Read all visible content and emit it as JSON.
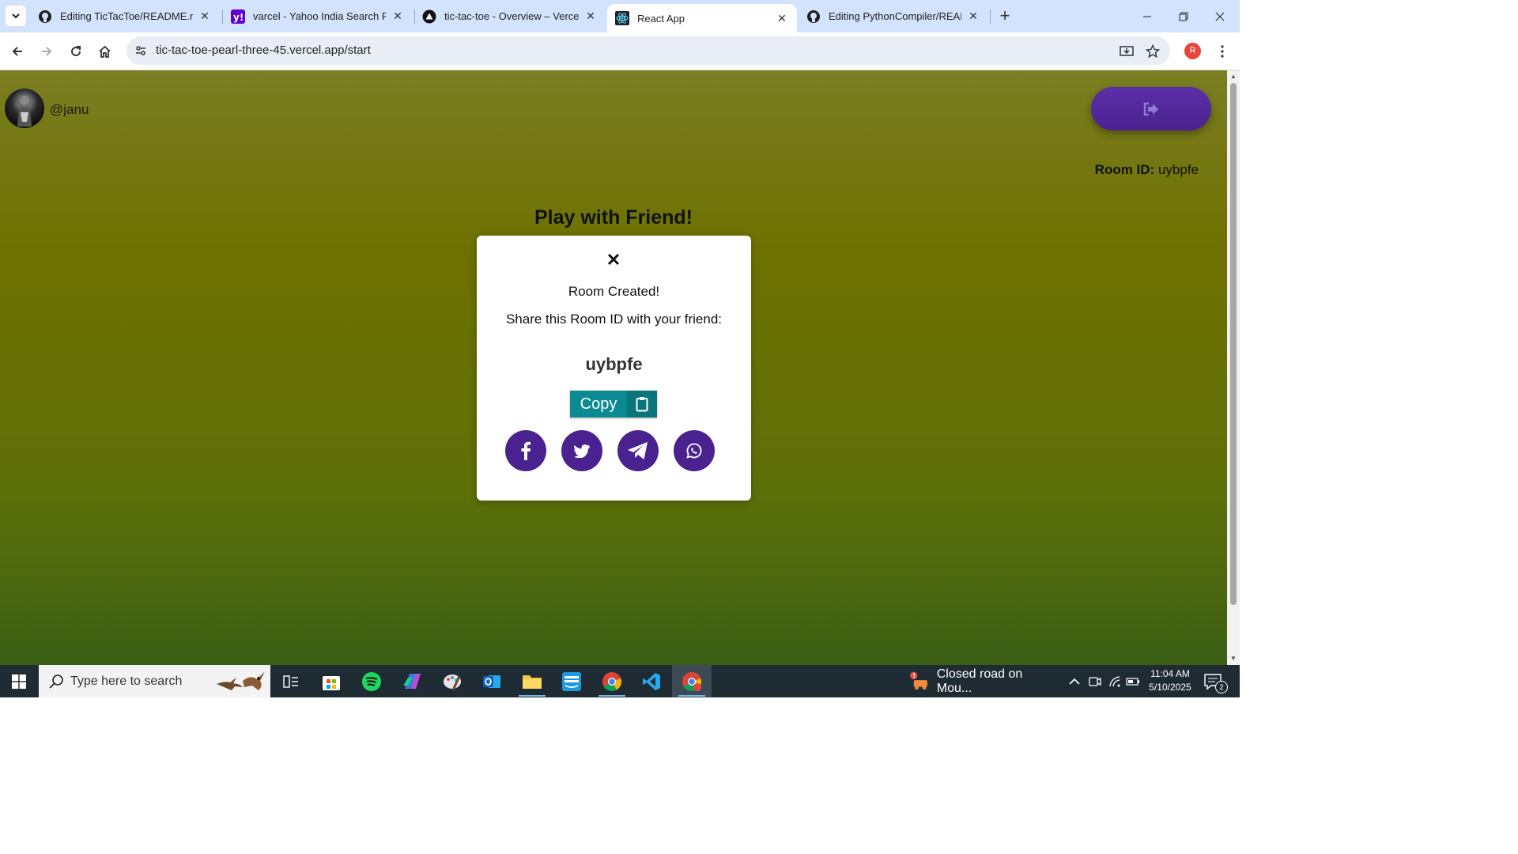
{
  "browser": {
    "tabs": [
      {
        "title": "Editing TicTacToe/README.md at main",
        "icon": "github-icon"
      },
      {
        "title": "varcel - Yahoo India Search Results",
        "icon": "yahoo-icon"
      },
      {
        "title": "tic-tac-toe - Overview – Vercel",
        "icon": "vercel-icon"
      },
      {
        "title": "React App",
        "icon": "react-icon",
        "active": true
      },
      {
        "title": "Editing PythonCompiler/README.md",
        "icon": "github-icon"
      }
    ],
    "url": "tic-tac-toe-pearl-three-45.vercel.app/start",
    "profile_initial": "R"
  },
  "app": {
    "username": "@janu",
    "room_id_label": "Room ID:",
    "room_id_value": "uybpfe",
    "heading": "Play with Friend!"
  },
  "modal": {
    "title": "Room Created!",
    "subtitle": "Share this Room ID with your friend:",
    "code": "uybpfe",
    "copy_label": "Copy",
    "share_targets": [
      "facebook",
      "twitter",
      "telegram",
      "whatsapp"
    ]
  },
  "taskbar": {
    "search_placeholder": "Type here to search",
    "news_text": "Closed road on Mou...",
    "time": "11:04 AM",
    "date": "5/10/2025",
    "notification_count": "2"
  },
  "colors": {
    "page_top": "#7b7e22",
    "page_bottom": "#3b5f15",
    "accent_purple": "#4a2290",
    "copy_teal": "#0c8a92"
  }
}
